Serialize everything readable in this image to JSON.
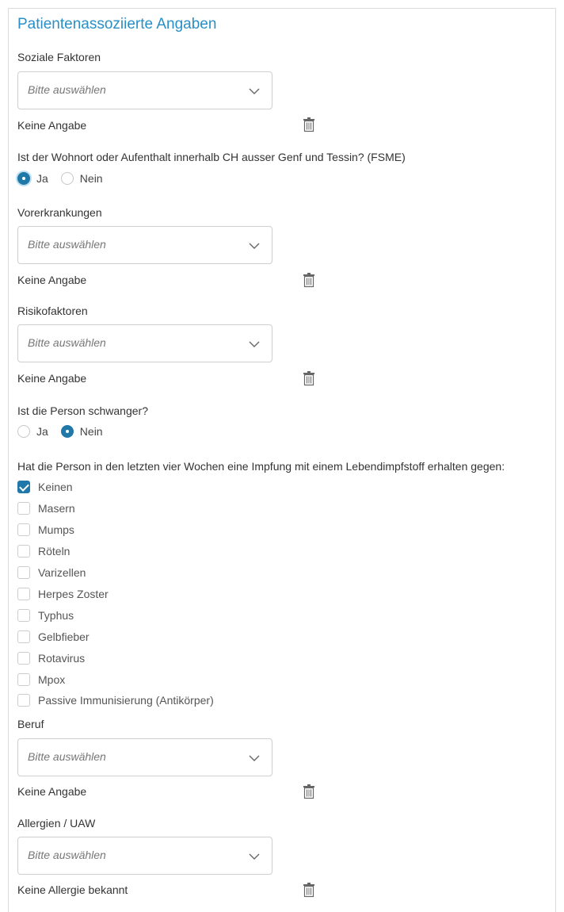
{
  "section_title": "Patientenassoziierte Angaben",
  "select_placeholder": "Bitte auswählen",
  "soziale_faktoren": {
    "label": "Soziale Faktoren",
    "value": "Keine Angabe"
  },
  "fsme": {
    "question": "Ist der Wohnort oder Aufenthalt innerhalb CH ausser Genf und Tessin? (FSME)",
    "options": [
      "Ja",
      "Nein"
    ],
    "selected": "Ja"
  },
  "vorerkrankungen": {
    "label": "Vorerkrankungen",
    "value": "Keine Angabe"
  },
  "risikofaktoren": {
    "label": "Risikofaktoren",
    "value": "Keine Angabe"
  },
  "schwanger": {
    "question": "Ist die Person schwanger?",
    "options": [
      "Ja",
      "Nein"
    ],
    "selected": "Nein"
  },
  "impfung": {
    "question": "Hat die Person in den letzten vier Wochen eine Impfung mit einem Lebendimpfstoff erhalten gegen:",
    "items": [
      {
        "label": "Keinen",
        "checked": true
      },
      {
        "label": "Masern",
        "checked": false
      },
      {
        "label": "Mumps",
        "checked": false
      },
      {
        "label": "Röteln",
        "checked": false
      },
      {
        "label": "Varizellen",
        "checked": false
      },
      {
        "label": "Herpes Zoster",
        "checked": false
      },
      {
        "label": "Typhus",
        "checked": false
      },
      {
        "label": "Gelbfieber",
        "checked": false
      },
      {
        "label": "Rotavirus",
        "checked": false
      },
      {
        "label": "Mpox",
        "checked": false
      },
      {
        "label": "Passive Immunisierung (Antikörper)",
        "checked": false
      }
    ]
  },
  "beruf": {
    "label": "Beruf",
    "value": "Keine Angabe"
  },
  "allergien": {
    "label": "Allergien / UAW",
    "value": "Keine Allergie bekannt"
  },
  "icons": {
    "select_arrow": "chevron-down-icon",
    "delete": "trash-icon"
  },
  "colors": {
    "accent": "#1f78a8",
    "title": "#2a8fc6"
  }
}
